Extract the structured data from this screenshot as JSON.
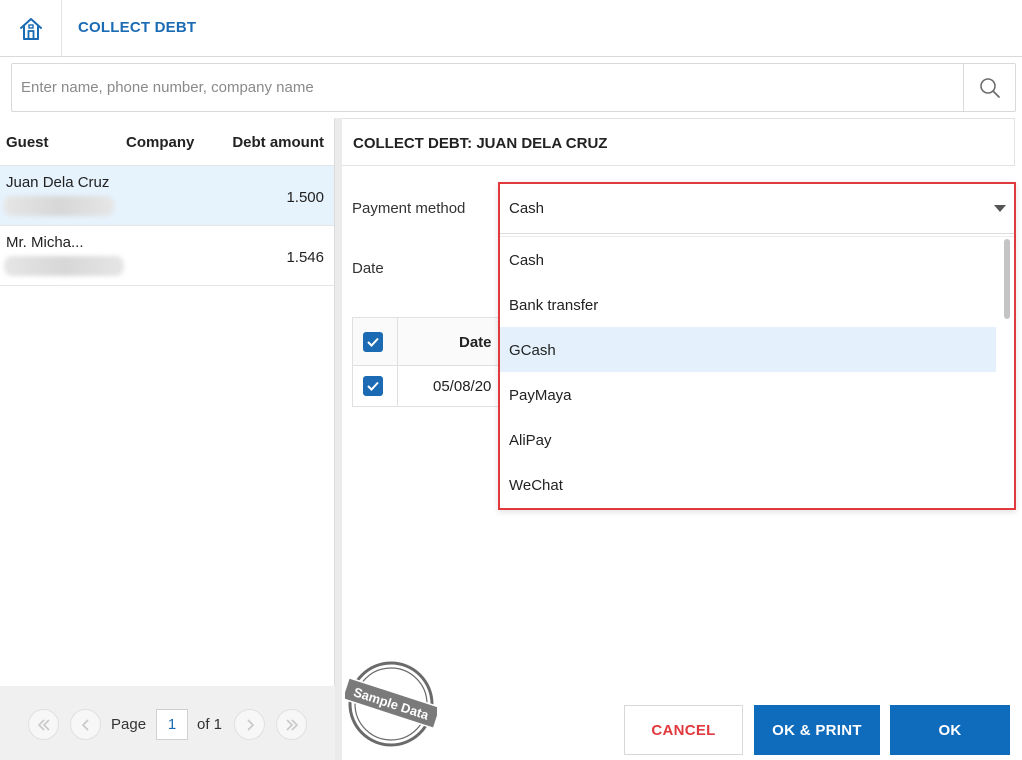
{
  "header": {
    "title": "COLLECT DEBT",
    "home_icon": "home-icon"
  },
  "search": {
    "placeholder": "Enter name, phone number, company name",
    "value": "",
    "icon": "search-icon"
  },
  "guest_list": {
    "columns": [
      "Guest",
      "Company",
      "Debt amount"
    ],
    "rows": [
      {
        "guest": "Juan Dela Cruz",
        "company": "",
        "debt": "1.500",
        "selected": true
      },
      {
        "guest": "Mr. Micha...",
        "company": "",
        "debt": "1.546",
        "selected": false
      }
    ]
  },
  "pagination": {
    "page_label": "Page",
    "page": "1",
    "of_label": "of 1"
  },
  "collect_panel": {
    "title": "COLLECT DEBT: JUAN DELA CRUZ",
    "payment_method_label": "Payment method",
    "payment_method_value": "Cash",
    "date_label": "Date",
    "table": {
      "date_header": "Date",
      "row_date": "05/08/20"
    }
  },
  "payment_options": [
    {
      "label": "Cash",
      "highlighted": false
    },
    {
      "label": "Bank transfer",
      "highlighted": false
    },
    {
      "label": "GCash",
      "highlighted": true
    },
    {
      "label": "PayMaya",
      "highlighted": false
    },
    {
      "label": "AliPay",
      "highlighted": false
    },
    {
      "label": "WeChat",
      "highlighted": false
    }
  ],
  "buttons": {
    "cancel": "CANCEL",
    "ok_print": "OK & PRINT",
    "ok": "OK"
  },
  "watermark": {
    "text": "Sample Data"
  },
  "colors": {
    "accent": "#0f6cbd",
    "title_blue": "#1a6bb3",
    "cancel_red": "#e0393e",
    "selected_row": "#e6f2fc"
  }
}
